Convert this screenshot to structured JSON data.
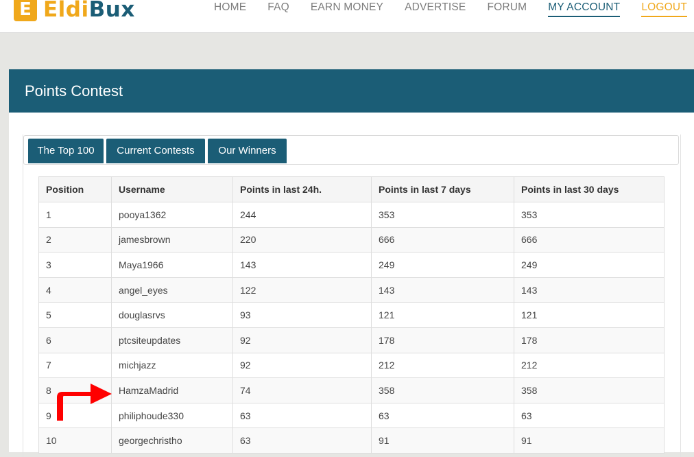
{
  "header": {
    "logo_mark": "E",
    "logo_text_part1": "Eldi",
    "logo_text_part2": "Bux",
    "nav": {
      "home": "HOME",
      "faq": "FAQ",
      "earn": "EARN MONEY",
      "advertise": "ADVERTISE",
      "forum": "FORUM",
      "account": "MY ACCOUNT",
      "logout": "LOGOUT"
    }
  },
  "panel": {
    "title": "Points Contest",
    "tabs": {
      "top100": "The Top 100",
      "current": "Current Contests",
      "winners": "Our Winners"
    }
  },
  "table": {
    "headers": {
      "position": "Position",
      "username": "Username",
      "p24": "Points in last 24h.",
      "p7": "Points in last 7 days",
      "p30": "Points in last 30 days"
    },
    "rows": [
      {
        "pos": "1",
        "user": "pooya1362",
        "p24": "244",
        "p7": "353",
        "p30": "353"
      },
      {
        "pos": "2",
        "user": "jamesbrown",
        "p24": "220",
        "p7": "666",
        "p30": "666"
      },
      {
        "pos": "3",
        "user": "Maya1966",
        "p24": "143",
        "p7": "249",
        "p30": "249"
      },
      {
        "pos": "4",
        "user": "angel_eyes",
        "p24": "122",
        "p7": "143",
        "p30": "143"
      },
      {
        "pos": "5",
        "user": "douglasrvs",
        "p24": "93",
        "p7": "121",
        "p30": "121"
      },
      {
        "pos": "6",
        "user": "ptcsiteupdates",
        "p24": "92",
        "p7": "178",
        "p30": "178"
      },
      {
        "pos": "7",
        "user": "michjazz",
        "p24": "92",
        "p7": "212",
        "p30": "212"
      },
      {
        "pos": "8",
        "user": "HamzaMadrid",
        "p24": "74",
        "p7": "358",
        "p30": "358"
      },
      {
        "pos": "9",
        "user": "philiphoude330",
        "p24": "63",
        "p7": "63",
        "p30": "63"
      },
      {
        "pos": "10",
        "user": "georgechristho",
        "p24": "63",
        "p7": "91",
        "p30": "91"
      }
    ]
  },
  "annotation": {
    "arrow_color": "#ff0000",
    "highlighted_row": "8"
  },
  "colors": {
    "brand_primary": "#1b5d76",
    "brand_accent": "#f0a81b"
  }
}
